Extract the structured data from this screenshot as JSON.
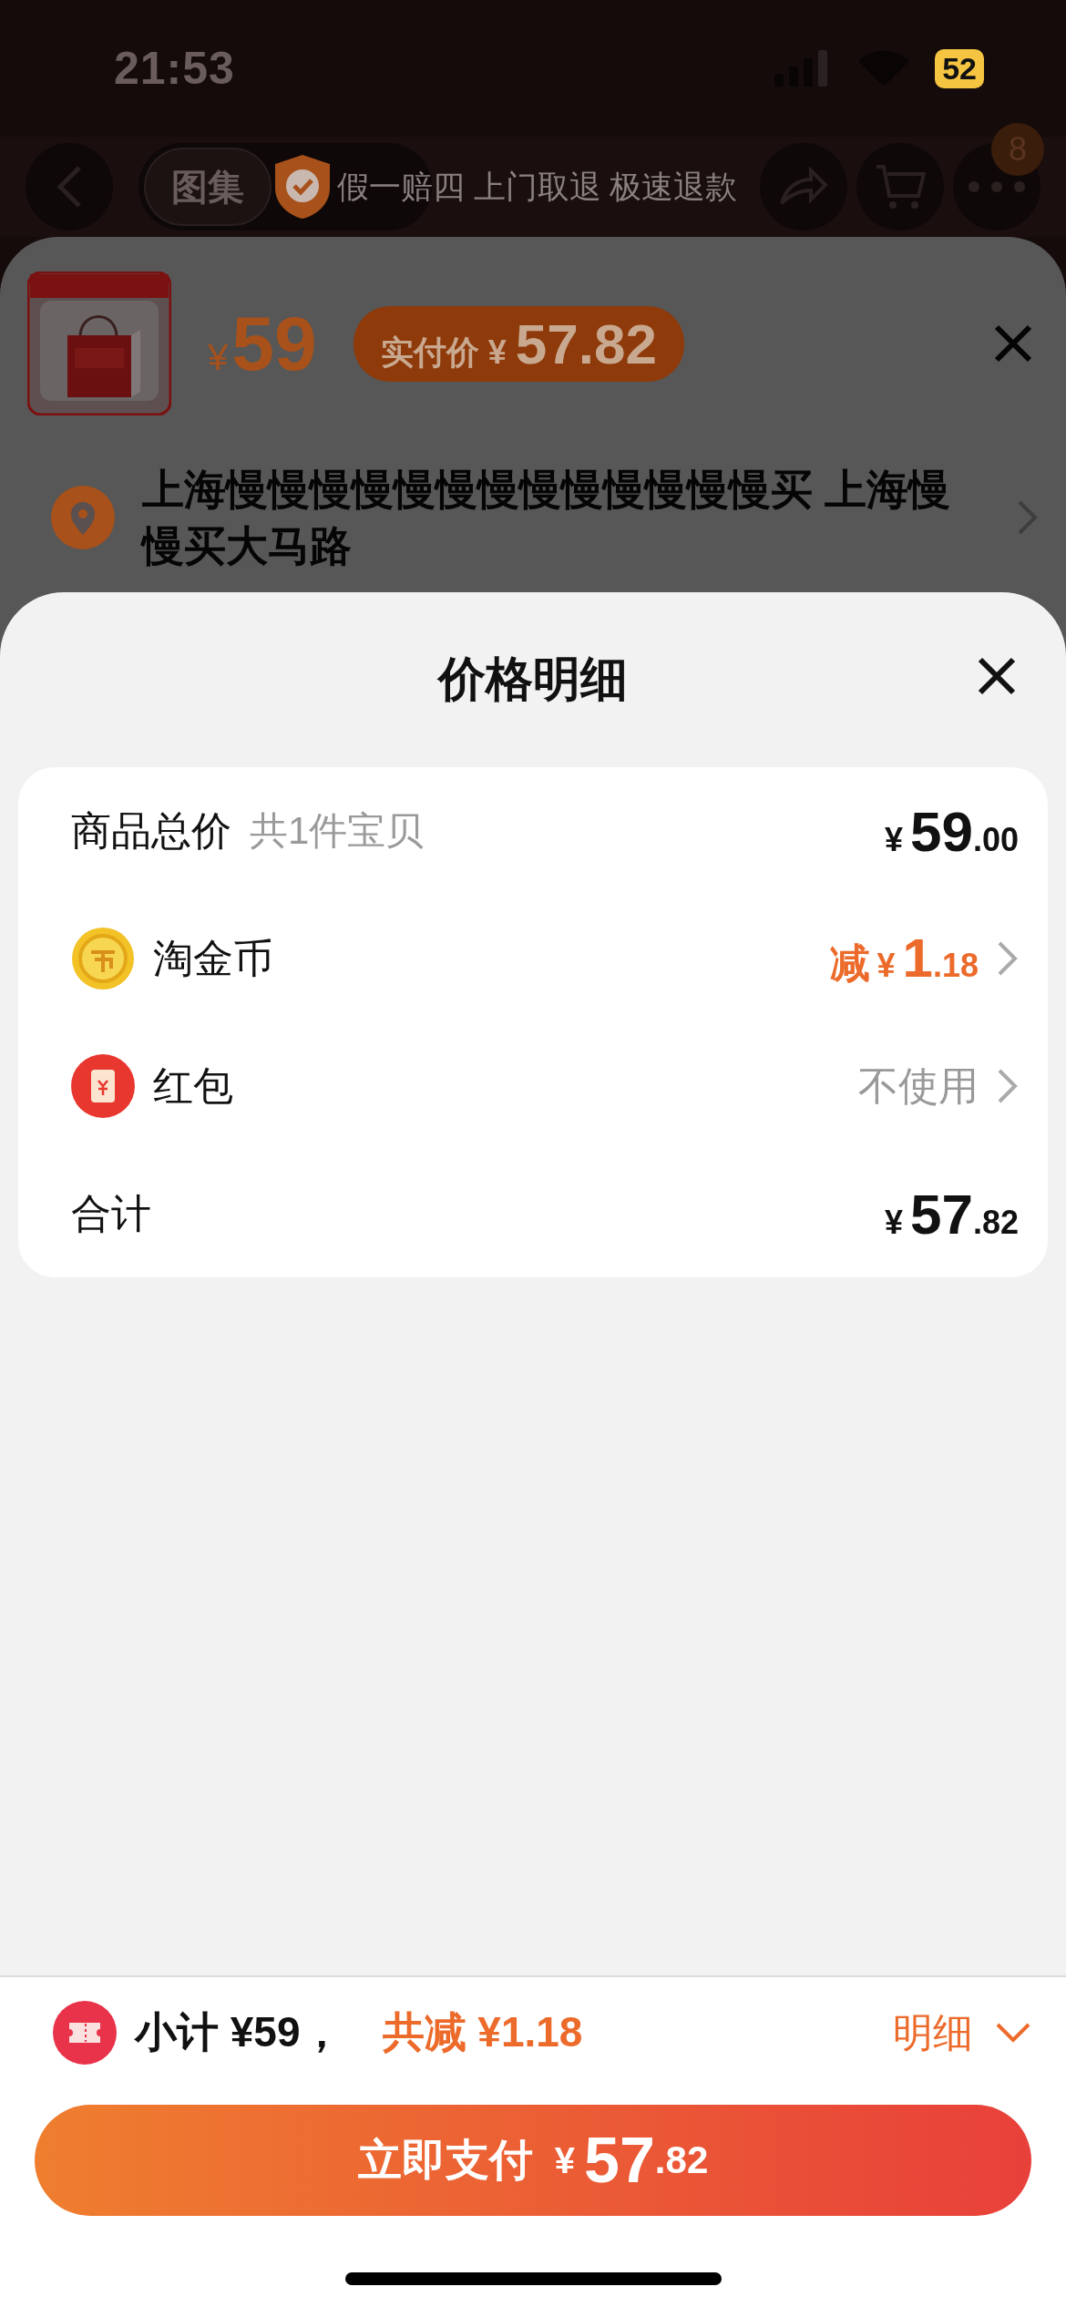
{
  "status_bar": {
    "time": "21:53",
    "battery": "52"
  },
  "nav": {
    "tabs": [
      {
        "label": "图集",
        "selected": true
      }
    ],
    "banner": "假一赔四 上门取退 极速退款",
    "more_badge": "8"
  },
  "product": {
    "kind": "picture",
    "price_symbol": "¥",
    "price": "59",
    "paid_label": "实付价",
    "paid_symbol": "¥",
    "paid_price": "57.82"
  },
  "address": {
    "text": "上海慢慢慢慢慢慢慢慢慢慢慢慢慢买 上海慢慢买大马路"
  },
  "detail": {
    "title": "价格明细",
    "rows": [
      {
        "kind": "total",
        "label": "商品总价",
        "sub": "共1件宝贝",
        "symbol": "¥",
        "int": "59",
        "dec": ".00"
      },
      {
        "kind": "discount",
        "label": "淘金币",
        "prefix": "减",
        "symbol": "¥",
        "int": "1",
        "dec": ".18"
      },
      {
        "kind": "option",
        "label": "红包",
        "value": "不使用"
      },
      {
        "kind": "sum",
        "label": "合计",
        "symbol": "¥",
        "int": "57",
        "dec": ".82"
      }
    ]
  },
  "footer": {
    "subtotal": "小计 ¥59，",
    "saved": "共减 ¥1.18",
    "toggle": "明细",
    "pay": {
      "label": "立即支付",
      "symbol": "¥",
      "int": "57",
      "dec": ".82"
    }
  }
}
